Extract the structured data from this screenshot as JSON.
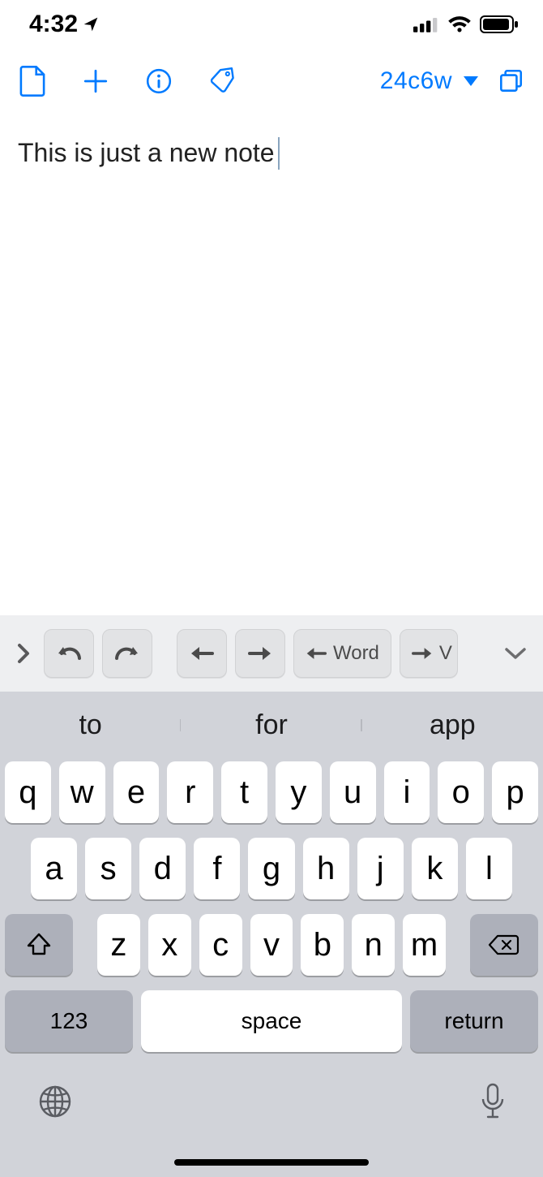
{
  "status": {
    "time": "4:32"
  },
  "toolbar": {
    "note_id": "24c6w"
  },
  "note": {
    "text": "This is just a new note"
  },
  "accessory": {
    "word_left": "Word",
    "word_right": "V"
  },
  "suggestions": [
    "to",
    "for",
    "app"
  ],
  "keys": {
    "row1": [
      "q",
      "w",
      "e",
      "r",
      "t",
      "y",
      "u",
      "i",
      "o",
      "p"
    ],
    "row2": [
      "a",
      "s",
      "d",
      "f",
      "g",
      "h",
      "j",
      "k",
      "l"
    ],
    "row3": [
      "z",
      "x",
      "c",
      "v",
      "b",
      "n",
      "m"
    ],
    "numbers": "123",
    "space": "space",
    "return": "return"
  }
}
